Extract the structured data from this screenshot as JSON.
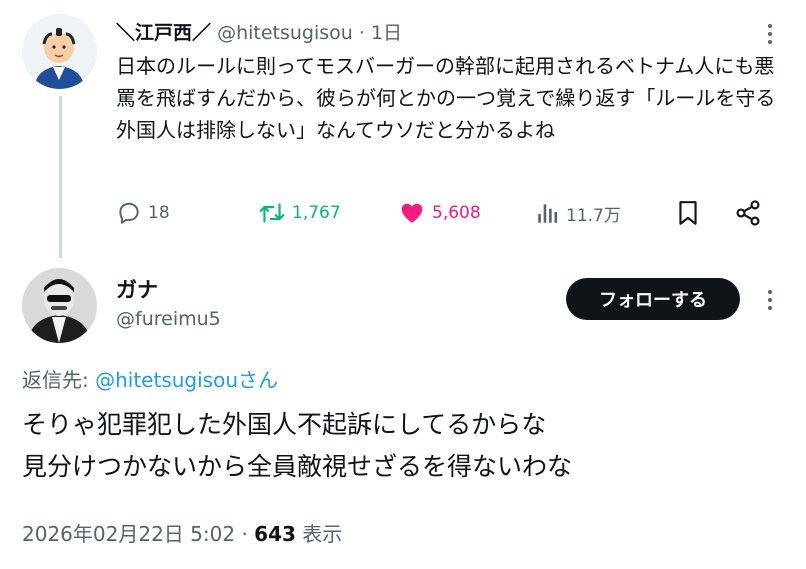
{
  "parent_tweet": {
    "display_name": "＼江戸西／",
    "handle": "@hitetsugisou",
    "separator": "·",
    "time_ago": "1日",
    "text": "日本のルールに則ってモスバーガーの幹部に起用されるベトナム人にも悪罵を飛ばすんだから、彼らが何とかの一つ覚えで繰り返す「ルールを守る外国人は排除しない」なんてウソだと分かるよね",
    "replies": "18",
    "retweets": "1,767",
    "likes": "5,608",
    "views": "11.7万"
  },
  "main_tweet": {
    "display_name": "ガナ",
    "handle": "@fureimu5",
    "follow_label": "フォローする",
    "reply_to_prefix": "返信先: ",
    "reply_to_handle": "@hitetsugisou",
    "reply_to_suffix": "さん",
    "text_line1": "そりゃ犯罪犯した外国人不起訴にしてるからな",
    "text_line2": "見分けつかないから全員敵視せざるを得ないわな",
    "date": "2026年02月22日 5:02",
    "separator": "·",
    "views_count": "643",
    "views_label": " 表示"
  },
  "icons": [
    "more-icon",
    "reply-icon",
    "retweet-icon",
    "like-icon",
    "views-icon",
    "bookmark-icon",
    "share-icon"
  ],
  "colors": {
    "retweet": "#00ba7c",
    "like": "#f91880",
    "link": "#1d9bf0",
    "muted": "#536471",
    "text": "#0f1419",
    "follow_button_bg": "#0f1419",
    "thread_line": "#cfd9de"
  }
}
